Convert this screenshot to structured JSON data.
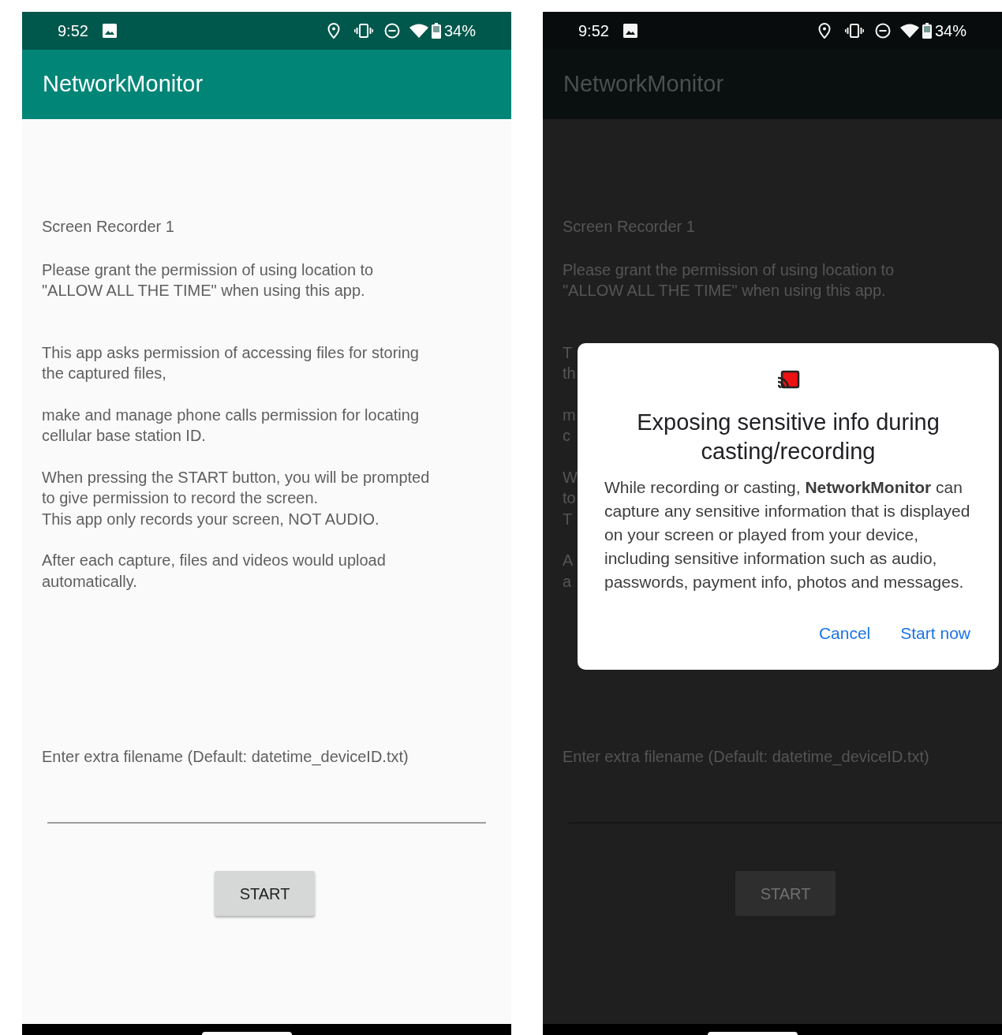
{
  "phones": [
    {
      "dimmed": false,
      "status_bar": {
        "time": "9:52",
        "battery": "34%"
      },
      "app_bar": {
        "title": "NetworkMonitor"
      },
      "paragraphs": [
        {
          "lines": [
            "Screen Recorder 1"
          ]
        },
        {
          "lines": [
            "Please grant the permission of using location to",
            "\"ALLOW ALL THE TIME\" when using this app."
          ]
        },
        {
          "lines": [
            "This app asks permission of accessing files for storing",
            "the captured files,"
          ]
        },
        {
          "lines": [
            "make and manage phone calls permission for locating",
            "cellular base station ID."
          ]
        },
        {
          "lines": [
            "When pressing the START button, you will be prompted",
            "to give permission to record the screen.",
            "This app only records your screen, NOT AUDIO."
          ]
        },
        {
          "lines": [
            "After each capture, files and videos would upload",
            "automatically."
          ]
        }
      ],
      "filename_label": "Enter extra filename (Default: datetime_deviceID.txt)",
      "start_button": "START"
    },
    {
      "dimmed": true,
      "status_bar": {
        "time": "9:52",
        "battery": "34%"
      },
      "app_bar": {
        "title": "NetworkMonitor"
      },
      "paragraphs": [
        {
          "lines": [
            "Screen Recorder 1"
          ]
        },
        {
          "lines": [
            "Please grant the permission of using location to",
            "\"ALLOW ALL THE TIME\" when using this app."
          ]
        },
        {
          "lines": [
            "T",
            "th"
          ]
        },
        {
          "lines": [
            "m",
            "c"
          ]
        },
        {
          "lines": [
            "W",
            "to",
            "T"
          ]
        },
        {
          "lines": [
            "A",
            "a"
          ]
        }
      ],
      "filename_label": "Enter extra filename (Default: datetime_deviceID.txt)",
      "start_button": "START",
      "dialog": {
        "title": "Exposing sensitive info during casting/recording",
        "body": "While recording or casting, **NetworkMonitor** can capture any sensitive information that is displayed on your screen or played from your device, including sensitive information such as audio, passwords, payment info, photos and messages.",
        "buttons": [
          "Cancel",
          "Start now"
        ]
      }
    }
  ]
}
